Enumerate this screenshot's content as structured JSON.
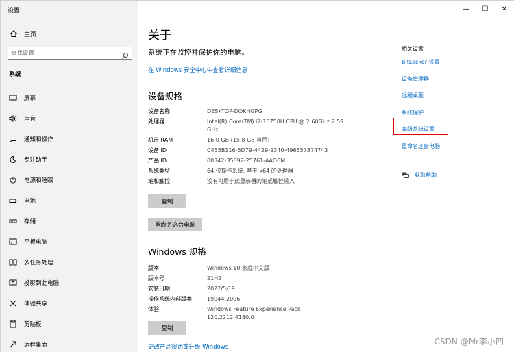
{
  "window": {
    "title": "设置",
    "controls": {
      "minimize": "—",
      "maximize": "☐",
      "close": "✕"
    }
  },
  "sidebar": {
    "home": "主页",
    "search_placeholder": "查找设置",
    "section": "系统",
    "items": [
      {
        "label": "屏幕",
        "icon": "monitor-icon"
      },
      {
        "label": "声音",
        "icon": "speaker-icon"
      },
      {
        "label": "通知和操作",
        "icon": "notification-icon"
      },
      {
        "label": "专注助手",
        "icon": "moon-icon"
      },
      {
        "label": "电源和睡眠",
        "icon": "power-icon"
      },
      {
        "label": "电池",
        "icon": "battery-icon"
      },
      {
        "label": "存储",
        "icon": "storage-icon"
      },
      {
        "label": "平板电脑",
        "icon": "tablet-icon"
      },
      {
        "label": "多任务处理",
        "icon": "multitask-icon"
      },
      {
        "label": "投影到此电脑",
        "icon": "project-icon"
      },
      {
        "label": "体验共享",
        "icon": "share-icon"
      },
      {
        "label": "剪贴板",
        "icon": "clipboard-icon"
      },
      {
        "label": "远程桌面",
        "icon": "remote-desktop-icon"
      }
    ]
  },
  "main": {
    "title": "关于",
    "protect_text": "系统正在监控并保护你的电脑。",
    "security_link": "在 Windows 安全中心中查看详细信息",
    "device_specs": {
      "heading": "设备规格",
      "rows": [
        {
          "k": "设备名称",
          "v": "DESKTOP-DOKHGPG"
        },
        {
          "k": "处理器",
          "v": "Intel(R) Core(TM) i7-10750H CPU @ 2.60GHz   2.59 GHz"
        },
        {
          "k": "机带 RAM",
          "v": "16.0 GB (15.8 GB 可用)"
        },
        {
          "k": "设备 ID",
          "v": "C455B116-5D79-4429-9340-496657874743"
        },
        {
          "k": "产品 ID",
          "v": "00342-35892-25761-AAOEM"
        },
        {
          "k": "系统类型",
          "v": "64 位操作系统, 基于 x64 的处理器"
        },
        {
          "k": "笔和触控",
          "v": "没有可用于此显示器的笔或触控输入"
        }
      ],
      "copy_button": "复制",
      "rename_button": "重命名这台电脑"
    },
    "windows_specs": {
      "heading": "Windows 规格",
      "rows": [
        {
          "k": "版本",
          "v": "Windows 10 家庭中文版"
        },
        {
          "k": "版本号",
          "v": "21H2"
        },
        {
          "k": "安装日期",
          "v": "2022/5/19"
        },
        {
          "k": "操作系统内部版本",
          "v": "19044.2006"
        },
        {
          "k": "体验",
          "v": "Windows Feature Experience Pack 120.2212.4180.0"
        }
      ],
      "copy_button": "复制"
    },
    "upgrade_link": "更改产品密钥或升级 Windows"
  },
  "related": {
    "title": "相关设置",
    "links": [
      "BitLocker 设置",
      "设备管理器",
      "远程桌面",
      "系统保护",
      "高级系统设置",
      "重命名这台电脑"
    ],
    "help": "获取帮助"
  },
  "watermark": "CSDN @Mr李小四",
  "colors": {
    "link": "#0067c0",
    "highlight": "#e00000",
    "sidebar_bg": "#f2f2f2",
    "button_bg": "#cccccc"
  }
}
